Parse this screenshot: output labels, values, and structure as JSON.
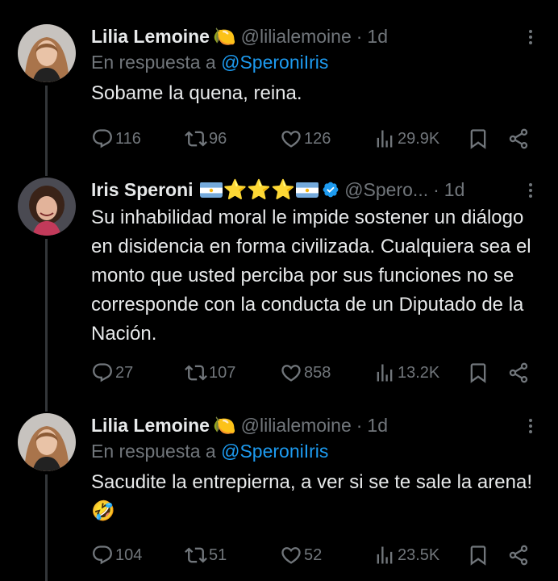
{
  "tweets": [
    {
      "name": "Lilia Lemoine",
      "name_emoji": "🍋",
      "handle": "@lilialemoine",
      "dot": "·",
      "time": "1d",
      "reply_prefix": "En respuesta a",
      "reply_handle": "@SperoniIris",
      "text": "Sobame la quena, reina.",
      "replies": "116",
      "retweets": "96",
      "likes": "126",
      "views": "29.9K"
    },
    {
      "name": "Iris Speroni",
      "name_decoration": "⭐⭐⭐",
      "handle": "@Spero...",
      "dot": "·",
      "time": "1d",
      "text": "Su inhabilidad moral le impide sostener un diálogo en disidencia en forma civilizada. Cualquiera sea el monto que usted perciba por sus funciones no se corresponde con la conducta de un Diputado de la Nación.",
      "replies": "27",
      "retweets": "107",
      "likes": "858",
      "views": "13.2K"
    },
    {
      "name": "Lilia Lemoine",
      "name_emoji": "🍋",
      "handle": "@lilialemoine",
      "dot": "·",
      "time": "1d",
      "reply_prefix": "En respuesta a",
      "reply_handle": "@SperoniIris",
      "text": "Sacudite la entrepierna, a ver si se te sale la arena! 🤣",
      "replies": "104",
      "retweets": "51",
      "likes": "52",
      "views": "23.5K"
    }
  ],
  "colors": {
    "background": "#000000",
    "text": "#e7e9ea",
    "muted": "#71767b",
    "link": "#1d9bf0",
    "verified": "#1d9bf0",
    "star": "#f5c518"
  }
}
